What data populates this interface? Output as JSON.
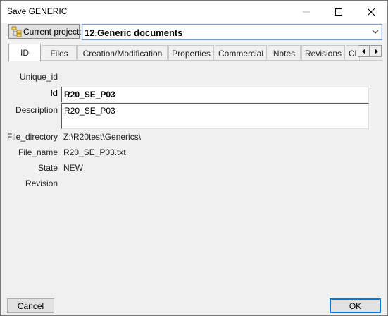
{
  "window": {
    "title": "Save  GENERIC"
  },
  "project": {
    "button_label": "Current project:",
    "value": "12.Generic documents"
  },
  "tabs": [
    {
      "label": "ID",
      "active": true
    },
    {
      "label": "Files"
    },
    {
      "label": "Creation/Modification"
    },
    {
      "label": "Properties"
    },
    {
      "label": "Commercial"
    },
    {
      "label": "Notes"
    },
    {
      "label": "Revisions"
    },
    {
      "label": "Cl"
    }
  ],
  "fields": {
    "unique_id_label": "Unique_id",
    "id_label": "Id",
    "id_value": "R20_SE_P03",
    "description_label": "Description",
    "description_value": "R20_SE_P03",
    "file_directory_label": "File_directory",
    "file_directory_value": "Z:\\R20test\\Generics\\",
    "file_name_label": "File_name",
    "file_name_value": "R20_SE_P03.txt",
    "state_label": "State",
    "state_value": "NEW",
    "revision_label": "Revision"
  },
  "buttons": {
    "cancel": "Cancel",
    "ok": "OK"
  }
}
